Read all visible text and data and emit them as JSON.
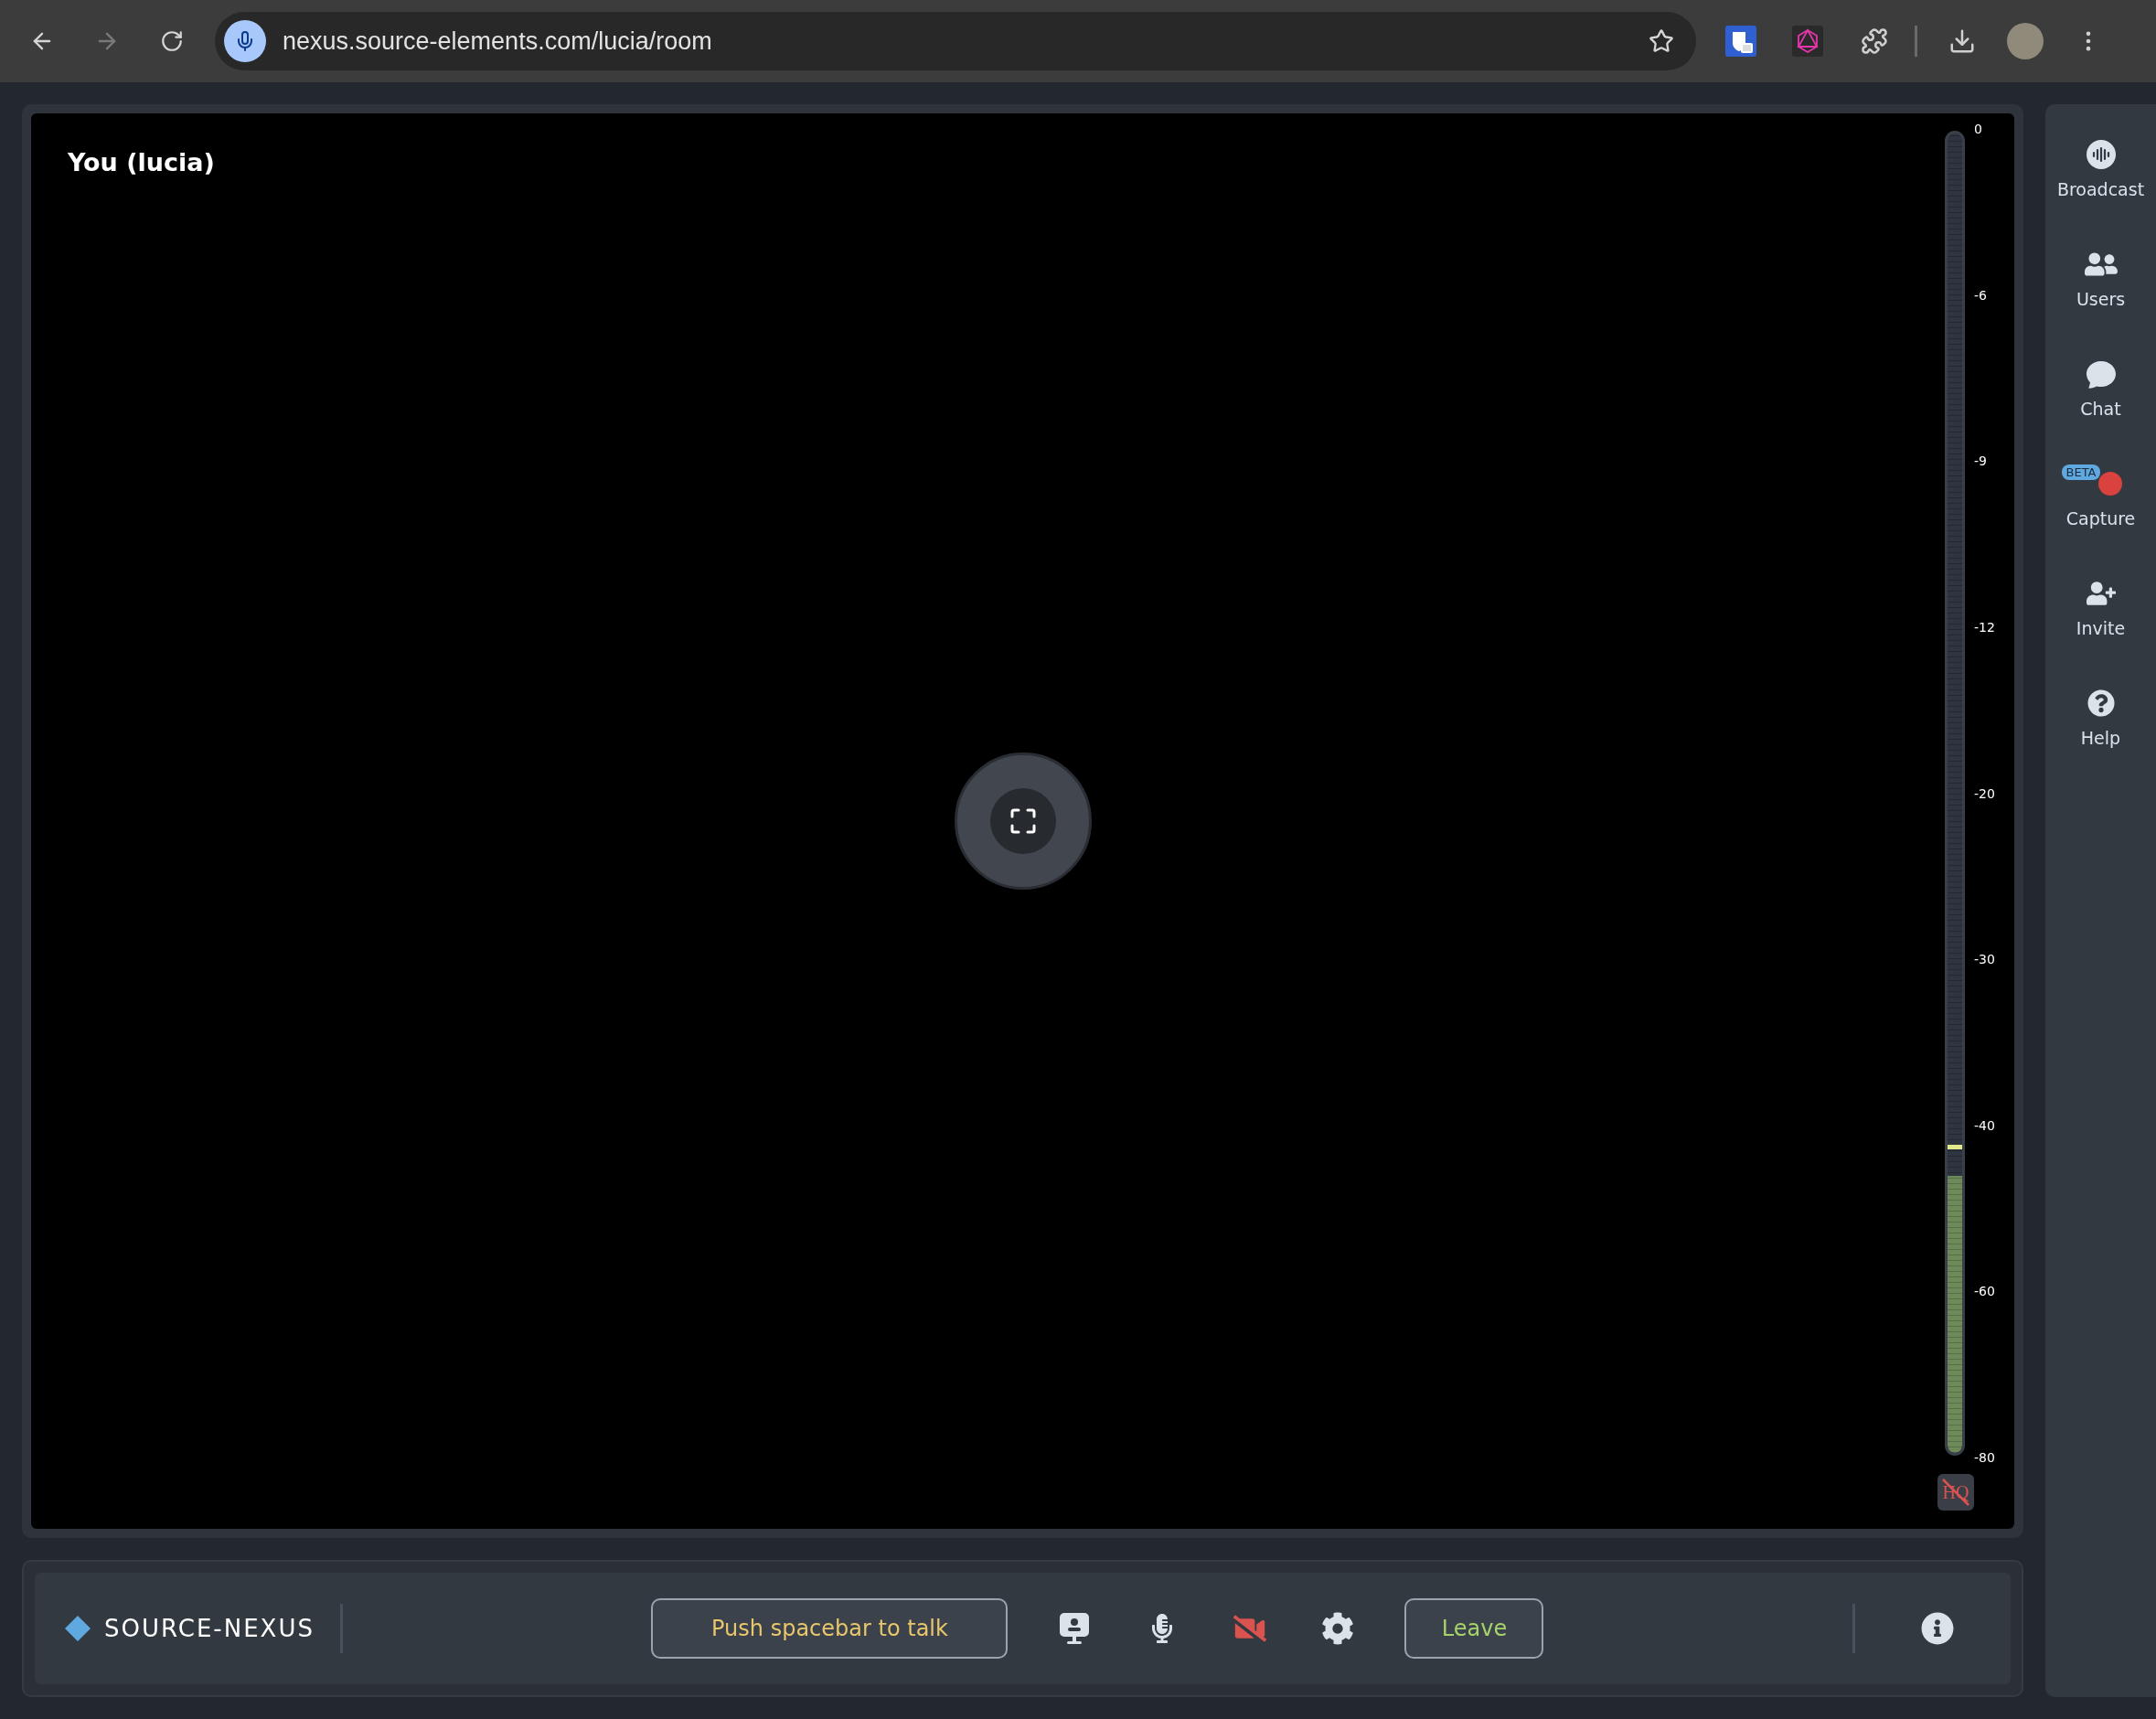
{
  "browser": {
    "nav_buttons": [
      {
        "kind": "back",
        "disabled": false
      },
      {
        "kind": "forward",
        "disabled": true
      },
      {
        "kind": "reload",
        "disabled": false
      }
    ],
    "url": "nexus.source-elements.com/lucia/room",
    "bookmarked": false
  },
  "video": {
    "participant": "You (lucia)"
  },
  "meter": {
    "scale": [
      "0",
      "-6",
      "-9",
      "-12",
      "-20",
      "-30",
      "-40",
      "-60",
      "-80"
    ],
    "level": 0.21,
    "peak": {
      "level": 0.23
    }
  },
  "hq_button": {
    "label": "HQ",
    "on": false
  },
  "sidebar": {
    "items": [
      {
        "kind": "broadcast",
        "label": "Broadcast"
      },
      {
        "kind": "users",
        "label": "Users"
      },
      {
        "kind": "chat",
        "label": "Chat"
      },
      {
        "kind": "capture",
        "label": "Capture",
        "badge": "BETA"
      },
      {
        "kind": "invite",
        "label": "Invite"
      },
      {
        "kind": "help",
        "label": "Help"
      }
    ]
  },
  "bottom_bar": {
    "brand": "SOURCE-NEXUS",
    "talk_button": "Push spacebar to talk",
    "controls": [
      {
        "kind": "presenter"
      },
      {
        "kind": "mic",
        "muted": false
      },
      {
        "kind": "camera",
        "muted": true
      },
      {
        "kind": "settings"
      }
    ],
    "leave_button": "Leave"
  }
}
